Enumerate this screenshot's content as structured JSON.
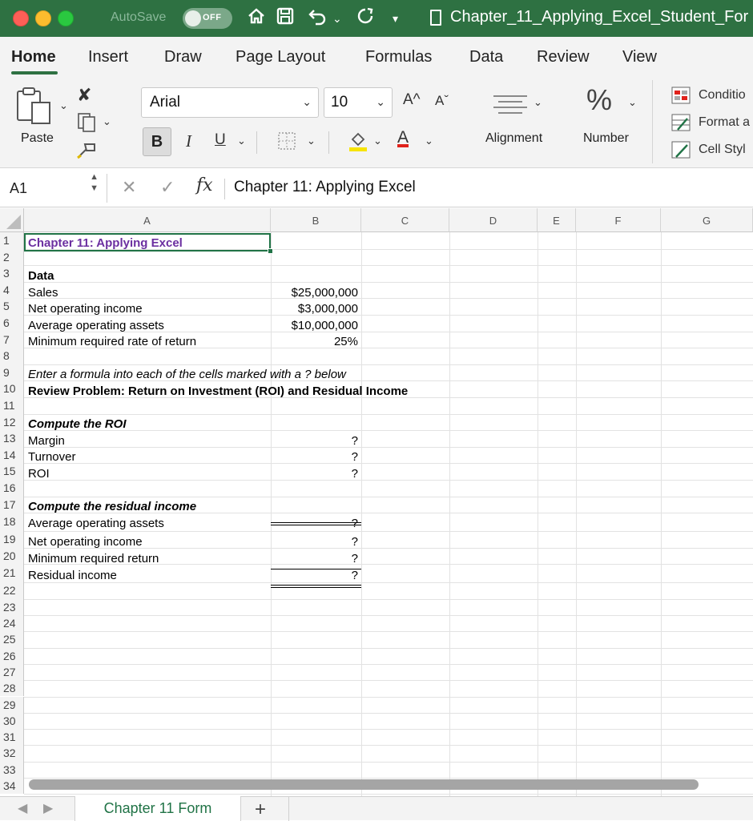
{
  "titlebar": {
    "autosave_label": "AutoSave",
    "toggle_label": "OFF",
    "document_title": "Chapter_11_Applying_Excel_Student_For"
  },
  "ribbon_tabs": [
    "Home",
    "Insert",
    "Draw",
    "Page Layout",
    "Formulas",
    "Data",
    "Review",
    "View"
  ],
  "ribbon": {
    "paste_label": "Paste",
    "font_name": "Arial",
    "font_size": "10",
    "bold_label": "B",
    "italic_label": "I",
    "underline_label": "U",
    "grow_font": "A^",
    "shrink_font": "Aˇ",
    "font_color_letter": "A",
    "font_color": "#e0221b",
    "fill_color": "#f7e400",
    "alignment_label": "Alignment",
    "number_label": "Number",
    "number_symbol": "%",
    "styles": [
      "Conditio",
      "Format a",
      "Cell Styl"
    ]
  },
  "formula_bar": {
    "name_box": "A1",
    "fx_label": "fx",
    "content": "Chapter 11: Applying Excel"
  },
  "columns": [
    "A",
    "B",
    "C",
    "D",
    "E",
    "F",
    "G"
  ],
  "rows": [
    "1",
    "2",
    "3",
    "4",
    "5",
    "6",
    "7",
    "8",
    "9",
    "10",
    "11",
    "12",
    "13",
    "14",
    "15",
    "16",
    "17",
    "18",
    "19",
    "20",
    "21",
    "22",
    "23",
    "24",
    "25",
    "26",
    "27",
    "28",
    "29",
    "30",
    "31",
    "32",
    "33",
    "34"
  ],
  "cells": {
    "A1": "Chapter 11: Applying Excel",
    "A3": "Data",
    "A4": "Sales",
    "B4": "$25,000,000",
    "A5": "Net operating income",
    "B5": "$3,000,000",
    "A6": "Average operating assets",
    "B6": "$10,000,000",
    "A7": "Minimum required rate of return",
    "B7": "25%",
    "A9": "Enter a formula into each of the cells marked with a ? below",
    "A10": "Review Problem: Return on Investment (ROI) and Residual Income",
    "A12": "Compute the ROI",
    "A13": "Margin",
    "B13": "?",
    "A14": "Turnover",
    "B14": "?",
    "A15": "ROI",
    "B15": "?",
    "A17": "Compute the residual income",
    "A18": "Average operating assets",
    "B18": "?",
    "A19": "Net operating income",
    "B19": "?",
    "A20": "Minimum required return",
    "B20": "?",
    "A21": "Residual income",
    "B21": "?"
  },
  "sheet_tabs": {
    "active": "Chapter 11 Form",
    "add_label": "+"
  },
  "accent": "#207346"
}
